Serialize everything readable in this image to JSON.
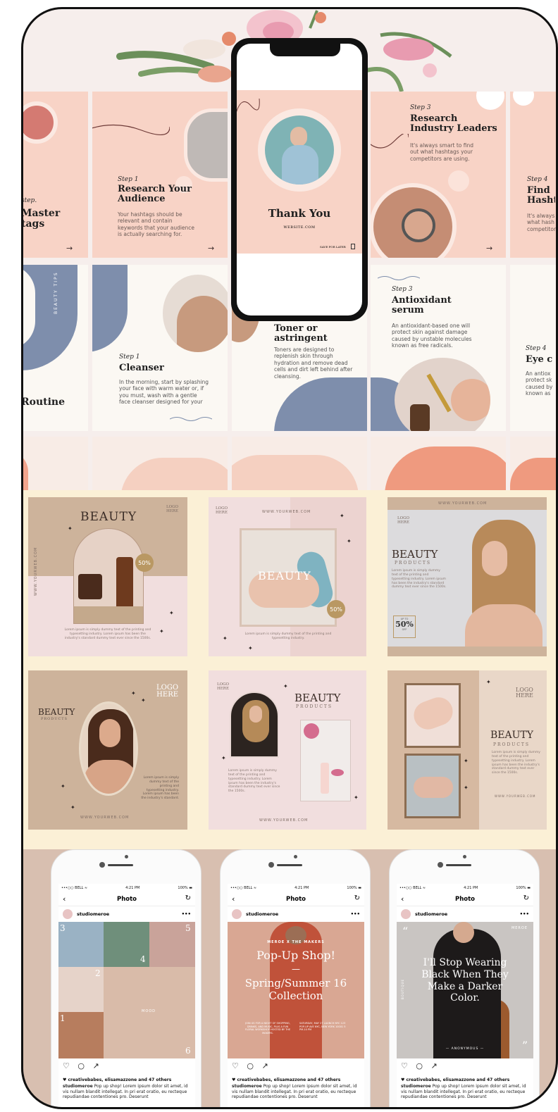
{
  "top_cards": {
    "card_left": {
      "step": "step.",
      "title": "Master\ntags"
    },
    "card1": {
      "step": "Step 1",
      "title": "Research Your Audience",
      "body": "Your hashtags should be relevant and contain keywords that your audience is actually searching for."
    },
    "card3": {
      "step": "Step 3",
      "title": "Research Industry Leaders",
      "body": "It's always smart to find out what hashtags your competitors are using."
    },
    "card4": {
      "step": "Step 4",
      "title": "Find Hasht",
      "body": "It's always what hash competitors"
    },
    "phone": {
      "title": "Thank You",
      "website": "WEBSITE.COM",
      "save": "SAVE FOR LATER"
    },
    "arrow": "→"
  },
  "routine_cards": {
    "left": {
      "vertical": "BEAUTY TIPS",
      "title": "Routine"
    },
    "card1": {
      "step": "Step 1",
      "title": "Cleanser",
      "body": "In the morning, start by splashing your face with warm water or, if you must, wash with a gentle face cleanser designed for your"
    },
    "card2": {
      "title": "Toner or astringent",
      "body": "Toners are designed to replenish skin through hydration and remove dead cells and dirt left behind after cleansing."
    },
    "card3": {
      "step": "Step 3",
      "title": "Antioxidant serum",
      "body": "An antioxidant-based one will protect skin against damage caused by unstable molecules known as free radicals."
    },
    "card4": {
      "step": "Step 4",
      "title": "Eye c",
      "body": "An antiox protect sk caused by known as"
    }
  },
  "beauty_posts": {
    "p1": {
      "title": "BEAUTY",
      "logo": "LOGO\nHERE",
      "side": "WWW.YOURWEB.COM",
      "badge": "50%",
      "lorem": "Lorem ipsum is simply dummy text of the printing and typesetting industry. Lorem ipsum has been the industry's standard dummy text ever since the 1500s."
    },
    "p2": {
      "logo": "LOGO\nHERE",
      "web": "WWW.YOURWEB.COM",
      "overlay": "BEAUTY",
      "badge": "50%",
      "lorem": "Lorem ipsum is simply dummy text of the printing and typesetting industry."
    },
    "p3": {
      "web": "WWW.YOURWEB.COM",
      "logo": "LOGO\nHERE",
      "title": "BEAUTY",
      "sub": "PRODUCTS",
      "lorem": "Lorem ipsum is simply dummy text of the printing and typesetting industry. Lorem ipsum has been the industry's standard dummy text ever since the 1500s.",
      "badge_top": "UP TO",
      "badge": "50%",
      "badge_bottom": "OFF"
    },
    "p4": {
      "title": "BEAUTY",
      "sub": "PRODUCTS",
      "logo": "LOGO\nHERE",
      "web": "WWW.YOURWEB.COM",
      "lorem": "Lorem ipsum is simply dummy text of the printing and typesetting industry. Lorem ipsum has been the industry's standard."
    },
    "p5": {
      "logo": "LOGO\nHERE",
      "title": "BEAUTY",
      "sub": "PRODUCTS",
      "lorem": "Lorem ipsum is simply dummy text of the printing and typesetting industry. Lorem ipsum has been the industry's standard dummy text ever since the 1500s.",
      "web": "WWW.YOURWEB.COM"
    },
    "p6": {
      "logo": "LOGO\nHERE",
      "title": "BEAUTY",
      "sub": "PRODUCTS",
      "lorem": "Lorem ipsum is simply dummy text of the printing and typesetting industry. Lorem ipsum has been the industry's standard dummy text ever since the 1500s.",
      "web": "WWW.YOURWEB.COM"
    }
  },
  "phones": [
    {
      "carrier": "•••○○ BELL ≈",
      "time": "4:21 PM",
      "battery": "100% ▬",
      "nav_title": "Photo",
      "user": "studiomeroe",
      "more": "•••",
      "grid_nums": [
        "3",
        "4",
        "5",
        "2",
        "1",
        "6"
      ],
      "mood": "MOOD",
      "likes": "♥ creativebabes, elisamazzone and 47 others",
      "caption_user": "studiomeroe",
      "caption": " Pop up shop! Lorem ipsum dolor sit amet, id vis nullam blandit intellegat. In pri erat oratio, eu recteque repudiandae contentiones pro. Deserunt"
    },
    {
      "carrier": "•••○○ BELL ≈",
      "time": "4:21 PM",
      "battery": "100% ▬",
      "nav_title": "Photo",
      "user": "studiomeroe",
      "more": "•••",
      "kicker": "MEROE X THE MAKERS",
      "title1": "Pop-Up Shop!",
      "dash": "—",
      "title2": "Spring/Summer 16 Collection",
      "small_left": "JOIN US FOR A NIGHT OF SHOPPING, DRINKS, AND MUSIC, PLUS A FUN FLORAL WORKSHOP HOSTED BY THE MAKERS.",
      "small_right": "SATURDAY, MAY 27 LAUNCH NYC 123 POP-UP AVE NYC, NEW YORK 10001 5 PM-10 PM",
      "likes": "♥ creativebabes, elisamazzone and 47 others",
      "caption_user": "studiomeroe",
      "caption": " Pop up shop! Lorem ipsum dolor sit amet, id vis nullam blandit intellegat. In pri erat oratio, eu recteque repudiandae contentiones pro. Deserunt"
    },
    {
      "carrier": "•••○○ BELL ≈",
      "time": "4:21 PM",
      "battery": "100% ▬",
      "nav_title": "Photo",
      "user": "studiomeroe",
      "more": "•••",
      "brand": "MEROE",
      "quote_open": "“",
      "quote_close": "”",
      "side": "BOUTIQUE",
      "quote": "I'll Stop Wearing Black When They Make a Darker Color.",
      "author": "— ANONYMOUS —",
      "likes": "♥ creativebabes, elisamazzone and 47 others",
      "caption_user": "studiomeroe",
      "caption": " Pop up shop! Lorem ipsum dolor sit amet, id vis nullam blandit intellegat. In pri erat oratio, eu recteque repudiandae contentiones pro. Deserunt"
    }
  ],
  "icons": {
    "back": "‹",
    "refresh": "↻",
    "actions": "♡ ○ ↗"
  }
}
